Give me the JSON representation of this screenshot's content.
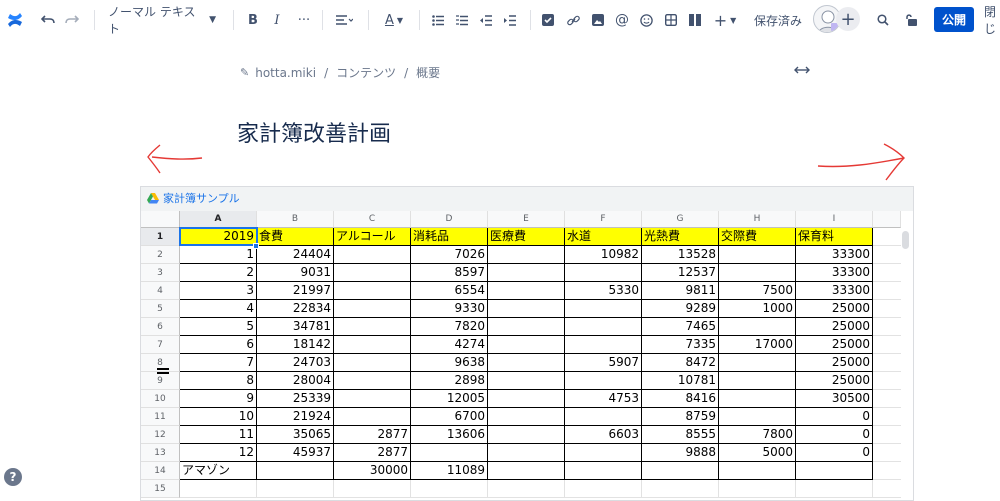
{
  "toolbar": {
    "text_style": "ノーマル テキスト",
    "saved_status": "保存済み",
    "publish_label": "公開",
    "close_label": "閉じ"
  },
  "breadcrumb": {
    "items": [
      "hotta.miki",
      "コンテンツ",
      "概要"
    ]
  },
  "page": {
    "title": "家計簿改善計画"
  },
  "embed": {
    "title": "家計簿サンプル"
  },
  "sheet": {
    "columns": [
      "A",
      "B",
      "C",
      "D",
      "E",
      "F",
      "G",
      "H",
      "I"
    ],
    "row_numbers": [
      "1",
      "2",
      "3",
      "4",
      "5",
      "6",
      "7",
      "8",
      "9",
      "10",
      "11",
      "12",
      "13",
      "14",
      "15"
    ],
    "rows": [
      [
        "2019",
        "食費",
        "アルコール",
        "消耗品",
        "医療費",
        "水道",
        "光熱費",
        "交際費",
        "保育料"
      ],
      [
        "1",
        "24404",
        "",
        "7026",
        "",
        "10982",
        "13528",
        "",
        "33300"
      ],
      [
        "2",
        "9031",
        "",
        "8597",
        "",
        "",
        "12537",
        "",
        "33300"
      ],
      [
        "3",
        "21997",
        "",
        "6554",
        "",
        "5330",
        "9811",
        "7500",
        "33300"
      ],
      [
        "4",
        "22834",
        "",
        "9330",
        "",
        "",
        "9289",
        "1000",
        "25000"
      ],
      [
        "5",
        "34781",
        "",
        "7820",
        "",
        "",
        "7465",
        "",
        "25000"
      ],
      [
        "6",
        "18142",
        "",
        "4274",
        "",
        "",
        "7335",
        "17000",
        "25000"
      ],
      [
        "7",
        "24703",
        "",
        "9638",
        "",
        "5907",
        "8472",
        "",
        "25000"
      ],
      [
        "8",
        "28004",
        "",
        "2898",
        "",
        "",
        "10781",
        "",
        "25000"
      ],
      [
        "9",
        "25339",
        "",
        "12005",
        "",
        "4753",
        "8416",
        "",
        "30500"
      ],
      [
        "10",
        "21924",
        "",
        "6700",
        "",
        "",
        "8759",
        "",
        "0"
      ],
      [
        "11",
        "35065",
        "2877",
        "13606",
        "",
        "6603",
        "8555",
        "7800",
        "0"
      ],
      [
        "12",
        "45937",
        "2877",
        "",
        "",
        "",
        "9888",
        "5000",
        "0"
      ],
      [
        "アマゾン",
        "",
        "30000",
        "11089",
        "",
        "",
        "",
        "",
        ""
      ],
      [
        "",
        "",
        "",
        "",
        "",
        "",
        "",
        "",
        ""
      ]
    ]
  },
  "colors": {
    "header_highlight": "#ffff00",
    "selection": "#1a73e8",
    "publish_button": "#0052cc",
    "annotation_arrows": "#e53935"
  }
}
